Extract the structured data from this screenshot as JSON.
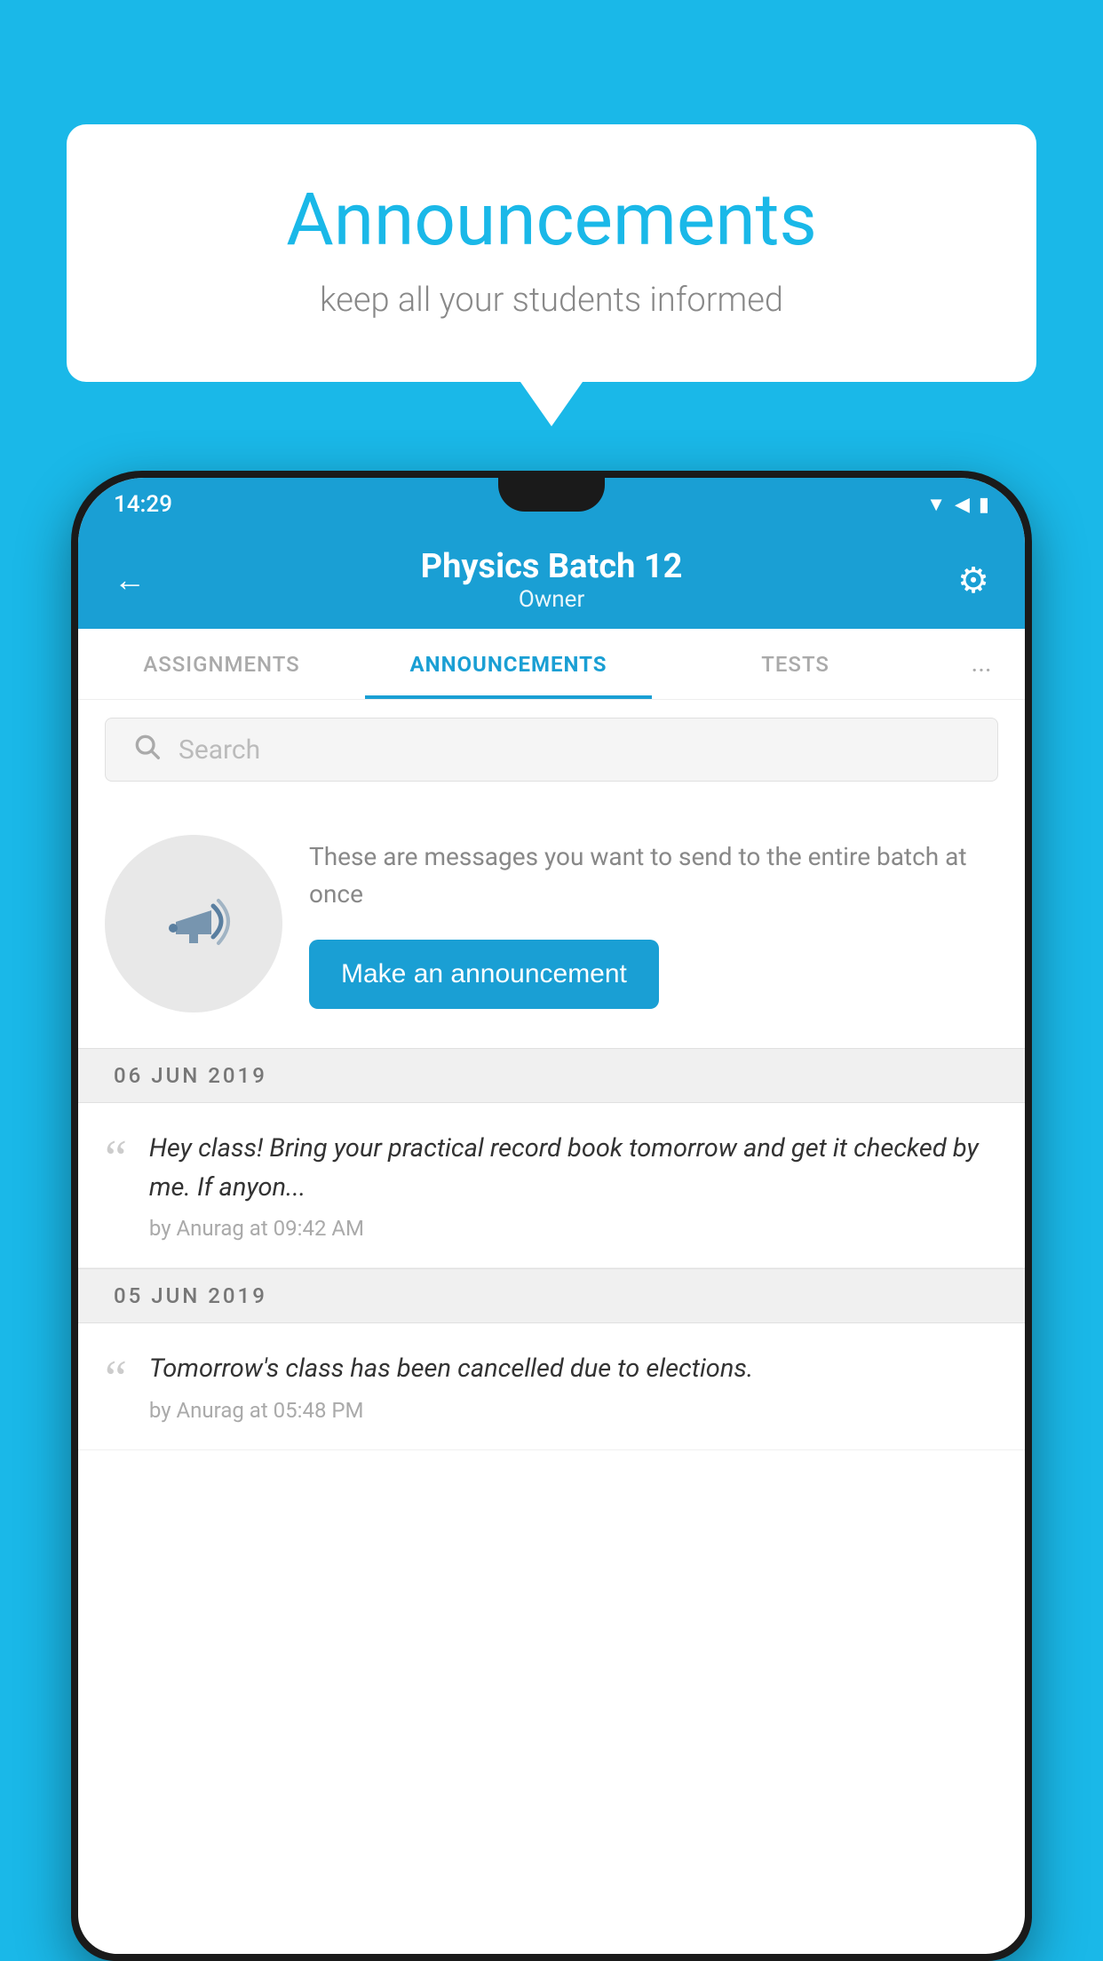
{
  "background_color": "#1ab8e8",
  "speech_bubble": {
    "title": "Announcements",
    "subtitle": "keep all your students informed"
  },
  "phone": {
    "status_bar": {
      "time": "14:29"
    },
    "header": {
      "title": "Physics Batch 12",
      "subtitle": "Owner",
      "back_label": "←",
      "gear_label": "⚙"
    },
    "tabs": [
      {
        "label": "ASSIGNMENTS",
        "active": false
      },
      {
        "label": "ANNOUNCEMENTS",
        "active": true
      },
      {
        "label": "TESTS",
        "active": false
      },
      {
        "label": "...",
        "active": false
      }
    ],
    "search": {
      "placeholder": "Search"
    },
    "empty_state": {
      "description_text": "These are messages you want to send to the entire batch at once",
      "cta_button": "Make an announcement"
    },
    "date_groups": [
      {
        "date_label": "06  JUN  2019",
        "announcements": [
          {
            "text": "Hey class! Bring your practical record book tomorrow and get it checked by me. If anyon...",
            "meta": "by Anurag at 09:42 AM"
          }
        ]
      },
      {
        "date_label": "05  JUN  2019",
        "announcements": [
          {
            "text": "Tomorrow's class has been cancelled due to elections.",
            "meta": "by Anurag at 05:48 PM"
          }
        ]
      }
    ]
  }
}
